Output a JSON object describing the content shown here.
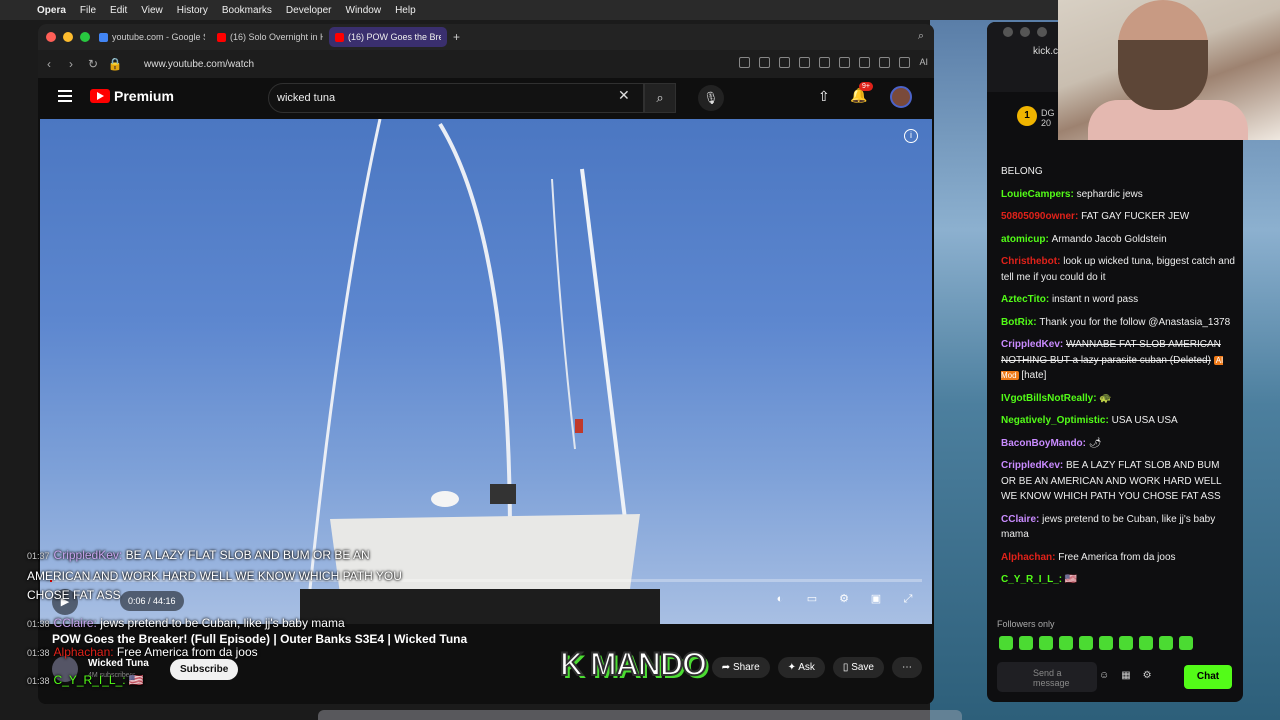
{
  "menubar": {
    "app": "Opera",
    "items": [
      "File",
      "Edit",
      "View",
      "History",
      "Bookmarks",
      "Developer",
      "Window",
      "Help"
    ]
  },
  "browser": {
    "tabs": [
      {
        "label": "youtube.com - Google S",
        "color": "#4285f4"
      },
      {
        "label": "(16) Solo Overnight in H",
        "color": "#ff0000"
      },
      {
        "label": "(16) POW Goes the Brea",
        "color": "#ff0000"
      }
    ],
    "url": "www.youtube.com/watch",
    "ai_label": "AI"
  },
  "youtube": {
    "brand": "Premium",
    "search_value": "wicked tuna",
    "notif_badge": "9+",
    "video": {
      "time": "0:06 / 44:16",
      "progress": 0.002,
      "title": "POW Goes the Breaker! (Full Episode) | Outer Banks S3E4 | Wicked Tuna",
      "channel": "Wicked Tuna",
      "subscribers": "4M subscribers",
      "subscribe_label": "Subscribe",
      "share_label": "Share",
      "ask_label": "Ask",
      "save_label": "Save"
    },
    "overlay": [
      {
        "time": "01:37",
        "user": "CrippledKev:",
        "text": "BE A LAZY FLAT SLOB AND BUM OR BE AN"
      },
      {
        "text": "AMERICAN AND WORK HARD WELL WE KNOW WHICH PATH YOU"
      },
      {
        "text": "CHOSE FAT ASS"
      },
      {
        "time": "01:38",
        "user": "CClaire:",
        "text": "jews pretend to be Cuban, like jj's baby mama"
      },
      {
        "time": "01:38",
        "user": "Alphachan:",
        "text": "Free America from da joos"
      },
      {
        "time": "01:38",
        "user": "C_Y_R_I_L_:",
        "text": "🇺🇸"
      }
    ],
    "watermark": "K MANDO"
  },
  "chat": {
    "site": "kick.com",
    "rank_name": "DG",
    "rank_number": "1",
    "rank_sub": "20",
    "messages": [
      {
        "user": "",
        "text": "BELONG",
        "color": "#eeeeee"
      },
      {
        "user": "LouieCampers:",
        "text": "sephardic jews",
        "color": "#53fc18"
      },
      {
        "user": "50805090owner:",
        "text": "FAT GAY FUCKER JEW",
        "color": "#e0221a"
      },
      {
        "user": "atomicup:",
        "text": "Armando Jacob Goldstein",
        "color": "#53fc18"
      },
      {
        "user": "Christhebot:",
        "text": "look up wicked tuna, biggest catch and tell me if you could do it",
        "color": "#e0221a"
      },
      {
        "user": "AztecTito:",
        "text": "instant n word pass",
        "color": "#53fc18"
      },
      {
        "user": "BotRix:",
        "text": "Thank you for the follow @Anastasia_1378",
        "color": "#53fc18"
      },
      {
        "user": "CrippledKev:",
        "text": "WANNABE FAT SLOB AMERICAN NOTHING BUT a lazy parasite cuban (Deleted)",
        "tag": "AI Mod",
        "extra": "[hate]",
        "color": "#c98bff"
      },
      {
        "user": "IVgotBillsNotReally:",
        "text": "🐢",
        "color": "#53fc18"
      },
      {
        "user": "Negatively_Optimistic:",
        "text": "USA USA USA",
        "color": "#53fc18"
      },
      {
        "user": "BaconBoyMando:",
        "text": "🌶",
        "color": "#c98bff"
      },
      {
        "user": "CrippledKev:",
        "text": "BE A LAZY FLAT SLOB AND BUM OR BE AN AMERICAN AND WORK HARD WELL WE KNOW WHICH PATH YOU CHOSE FAT ASS",
        "color": "#c98bff"
      },
      {
        "user": "CClaire:",
        "text": "jews pretend to be Cuban, like jj's baby mama",
        "color": "#c98bff"
      },
      {
        "user": "Alphachan:",
        "text": "Free America from da joos",
        "color": "#e0221a"
      },
      {
        "user": "C_Y_R_I_L_:",
        "text": "🇺🇸",
        "color": "#53fc18"
      }
    ],
    "followers_only": "Followers only",
    "send_placeholder": "Send a message",
    "chat_button": "Chat"
  }
}
